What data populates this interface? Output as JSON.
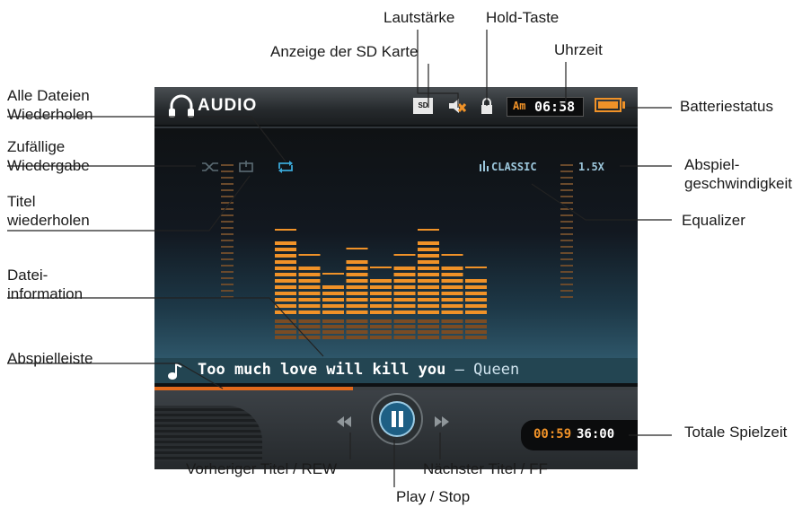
{
  "screen": {
    "app_title": "AUDIO",
    "sd_card_label": "SD",
    "clock_ampm": "Am",
    "clock_time": "06:58",
    "eq_preset": "CLASSIC",
    "playback_speed": "1.5X",
    "song_title": "Too much love will kill you",
    "song_separator": " – ",
    "song_artist": "Queen",
    "elapsed_time": "00:59",
    "total_time": "36:00",
    "progress_fraction": 0.41,
    "battery_fraction": 1.0,
    "equalizer_levels": [
      0.78,
      0.52,
      0.34,
      0.54,
      0.4,
      0.49,
      0.78,
      0.52,
      0.38
    ]
  },
  "labels": {
    "volume": "Lautstärke",
    "hold": "Hold-Taste",
    "sd_card": "Anzeige der SD Karte",
    "clock": "Uhrzeit",
    "repeat_all_line1": "Alle Dateien",
    "repeat_all_line2": "Wiederholen",
    "battery": "Batteriestatus",
    "shuffle_line1": "Zufällige",
    "shuffle_line2": "Wiedergabe",
    "speed_line1": "Abspiel-",
    "speed_line2": "geschwindigkeit",
    "repeat_one_line1": "Titel",
    "repeat_one_line2": "wiederholen",
    "equalizer": "Equalizer",
    "file_info_line1": "Datei-",
    "file_info_line2": "information",
    "progress_bar": "Abspielleiste",
    "total_time": "Totale Spielzeit",
    "prev": "Vorheriger Titel / REW",
    "next": "Nächster Titel / FF",
    "play": "Play / Stop"
  },
  "colors": {
    "accent_orange": "#f09228",
    "screen_text": "#9cc7dc",
    "bar_orange": "#f09228",
    "bar_reflection": "#7a4c24"
  },
  "icons": {
    "app": "headphones-icon",
    "volume": "speaker-muted-icon",
    "hold": "lock-icon",
    "shuffle": "shuffle-icon",
    "repeat_one": "repeat-one-icon",
    "repeat_all": "repeat-all-icon",
    "play_pause": "pause-icon",
    "prev": "rewind-icon",
    "next": "fast-forward-icon",
    "music_note": "music-note-icon"
  }
}
